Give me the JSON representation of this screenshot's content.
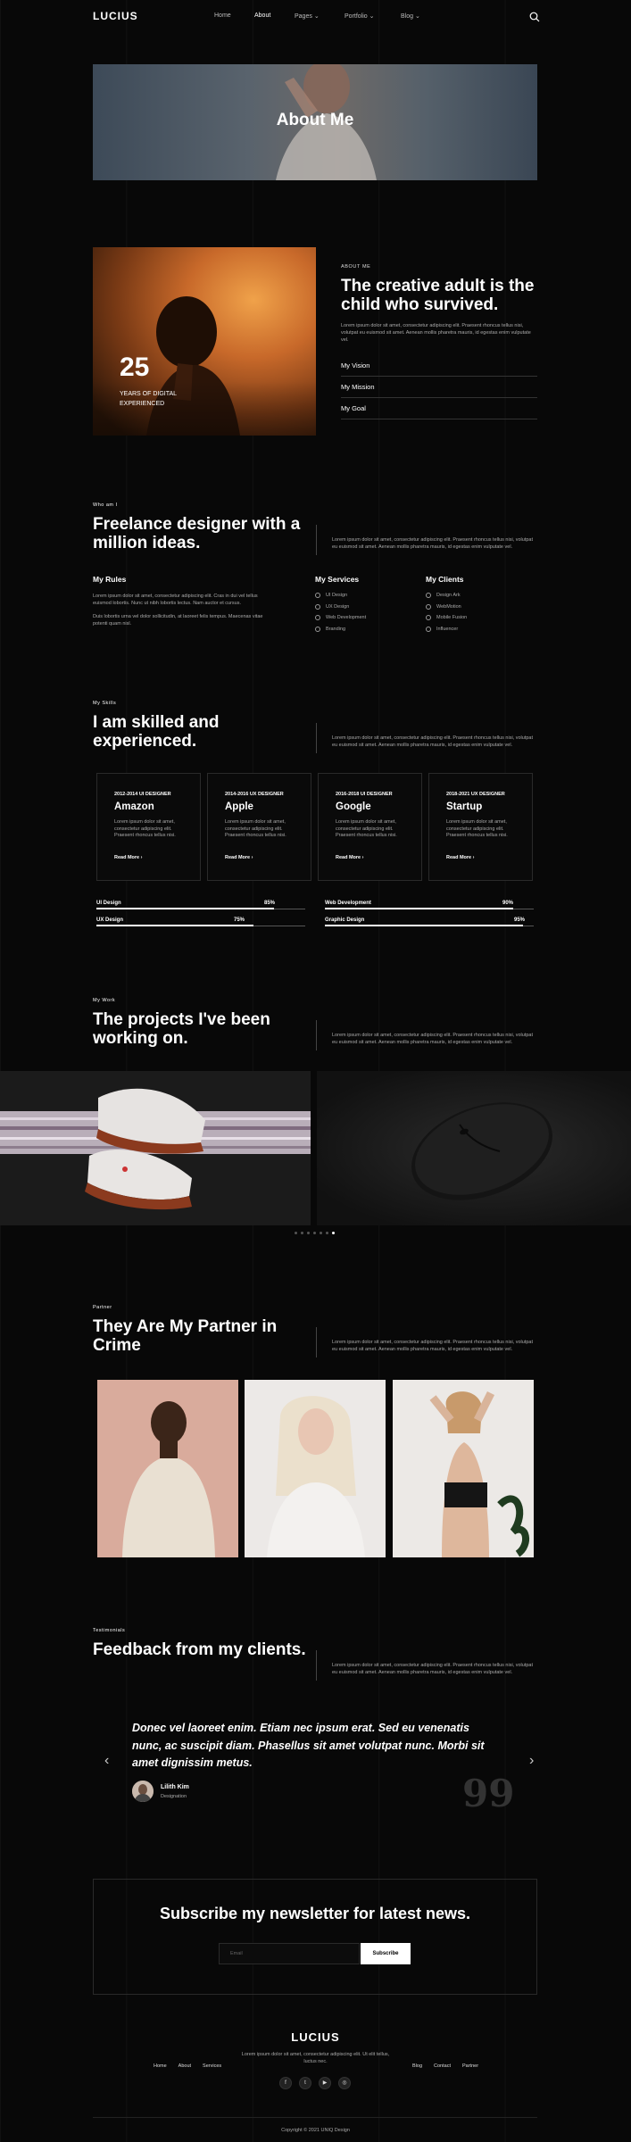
{
  "header": {
    "logo": "LUCIUS",
    "nav": [
      {
        "label": "Home",
        "dropdown": false
      },
      {
        "label": "About",
        "dropdown": false
      },
      {
        "label": "Pages",
        "dropdown": true
      },
      {
        "label": "Portfolio",
        "dropdown": true
      },
      {
        "label": "Blog",
        "dropdown": true
      }
    ]
  },
  "hero": {
    "title": "About Me"
  },
  "about": {
    "years": "25",
    "years_label": "Years of digital experienced",
    "sub": "About Me",
    "heading": "The creative adult is the child who survived.",
    "para": "Lorem ipsum dolor sit amet, consectetur adipiscing elit. Praesent rhoncus tellus nisi, volutpat eu euismod sit amet. Aenean mollis pharetra mauris, id egestas enim vulputate vel.",
    "accordion": [
      "My Vision",
      "My Mission",
      "My Goal"
    ]
  },
  "who": {
    "label": "Who am I",
    "heading": "Freelance designer with a million ideas.",
    "para": "Lorem ipsum dolor sit amet, consectetur adipiscing elit. Praesent rhoncus tellus nisi, volutpat eu euismod sit amet. Aenean mollis pharetra mauris, id egestas enim vulputate vel.",
    "rules_title": "My Rules",
    "rules_p1": "Lorem ipsum dolor sit amet, consectetur adipiscing elit. Cras in dui vel tellus euismod lobortis. Nunc ut nibh lobortis lectus. Nam auctor et cursus.",
    "rules_p2": "Duis lobortis urna vel dolor sollicitudin, at laoreet felis tempus. Maecenas vitae potenti quam nisl.",
    "services_title": "My Services",
    "services": [
      "UI Design",
      "UX Design",
      "Web Development",
      "Branding"
    ],
    "clients_title": "My Clients",
    "clients": [
      "Design Ark",
      "WebMotion",
      "Mobile Fusion",
      "Influencer"
    ]
  },
  "skills": {
    "label": "My Skills",
    "heading": "I am skilled and experienced.",
    "para": "Lorem ipsum dolor sit amet, consectetur adipiscing elit. Praesent rhoncus tellus nisi, volutpat eu euismod sit amet. Aenean mollis pharetra mauris, id egestas enim vulputate vel.",
    "cards": [
      {
        "years": "2012-2014 UI DESIGNER",
        "company": "Amazon",
        "desc": "Lorem ipsum dolor sit amet, consectetur adipiscing elit. Praesent rhoncus tellus nisi.",
        "link": "Read More"
      },
      {
        "years": "2014-2016 UX DESIGNER",
        "company": "Apple",
        "desc": "Lorem ipsum dolor sit amet, consectetur adipiscing elit. Praesent rhoncus tellus nisi.",
        "link": "Read More"
      },
      {
        "years": "2016-2018 UI DESIGNER",
        "company": "Google",
        "desc": "Lorem ipsum dolor sit amet, consectetur adipiscing elit. Praesent rhoncus tellus nisi.",
        "link": "Read More"
      },
      {
        "years": "2018-2021 UX DESIGNER",
        "company": "Startup",
        "desc": "Lorem ipsum dolor sit amet, consectetur adipiscing elit. Praesent rhoncus tellus nisi.",
        "link": "Read More"
      }
    ],
    "bars": [
      {
        "label": "UI Design",
        "pct": "85%",
        "value": 0.85
      },
      {
        "label": "Web Development",
        "pct": "90%",
        "value": 0.9
      },
      {
        "label": "UX Design",
        "pct": "75%",
        "value": 0.75
      },
      {
        "label": "Graphic Design",
        "pct": "95%",
        "value": 0.95
      }
    ]
  },
  "work": {
    "label": "My Work",
    "heading": "The projects I've been working on.",
    "para": "Lorem ipsum dolor sit amet, consectetur adipiscing elit. Praesent rhoncus tellus nisi, volutpat eu euismod sit amet. Aenean mollis pharetra mauris, id egestas enim vulputate vel.",
    "dots": 7,
    "active_dot": 6
  },
  "partner": {
    "label": "Partner",
    "heading": "They Are My Partner in Crime",
    "para": "Lorem ipsum dolor sit amet, consectetur adipiscing elit. Praesent rhoncus tellus nisi, volutpat eu euismod sit amet. Aenean mollis pharetra mauris, id egestas enim vulputate vel."
  },
  "testimonials": {
    "label": "Testimonials",
    "heading": "Feedback from my clients.",
    "para": "Lorem ipsum dolor sit amet, consectetur adipiscing elit. Praesent rhoncus tellus nisi, volutpat eu euismod sit amet. Aenean mollis pharetra mauris, id egestas enim vulputate vel.",
    "quote": "Donec vel laoreet enim. Etiam nec ipsum erat. Sed eu venenatis nunc, ac suscipit diam. Phasellus sit amet volutpat nunc. Morbi sit amet dignissim metus.",
    "author": "Lilith Kim",
    "role": "Designation",
    "quote_mark": "99"
  },
  "newsletter": {
    "title": "Subscribe my newsletter for latest news.",
    "placeholder": "Email",
    "button": "Subscribe"
  },
  "footer": {
    "logo": "LUCIUS",
    "tagline": "Lorem ipsum dolor sit amet, consectetur adipiscing elit. Ut elit tellus, luctus nec.",
    "left_links": [
      "Home",
      "About",
      "Services"
    ],
    "right_links": [
      "Blog",
      "Contact",
      "Partner"
    ],
    "social": [
      {
        "icon": "facebook-icon",
        "glyph": "f"
      },
      {
        "icon": "twitter-icon",
        "glyph": "t"
      },
      {
        "icon": "youtube-icon",
        "glyph": "▶"
      },
      {
        "icon": "instagram-icon",
        "glyph": "◎"
      }
    ],
    "copyright": "Copyright © 2021 UNIQ Design"
  }
}
